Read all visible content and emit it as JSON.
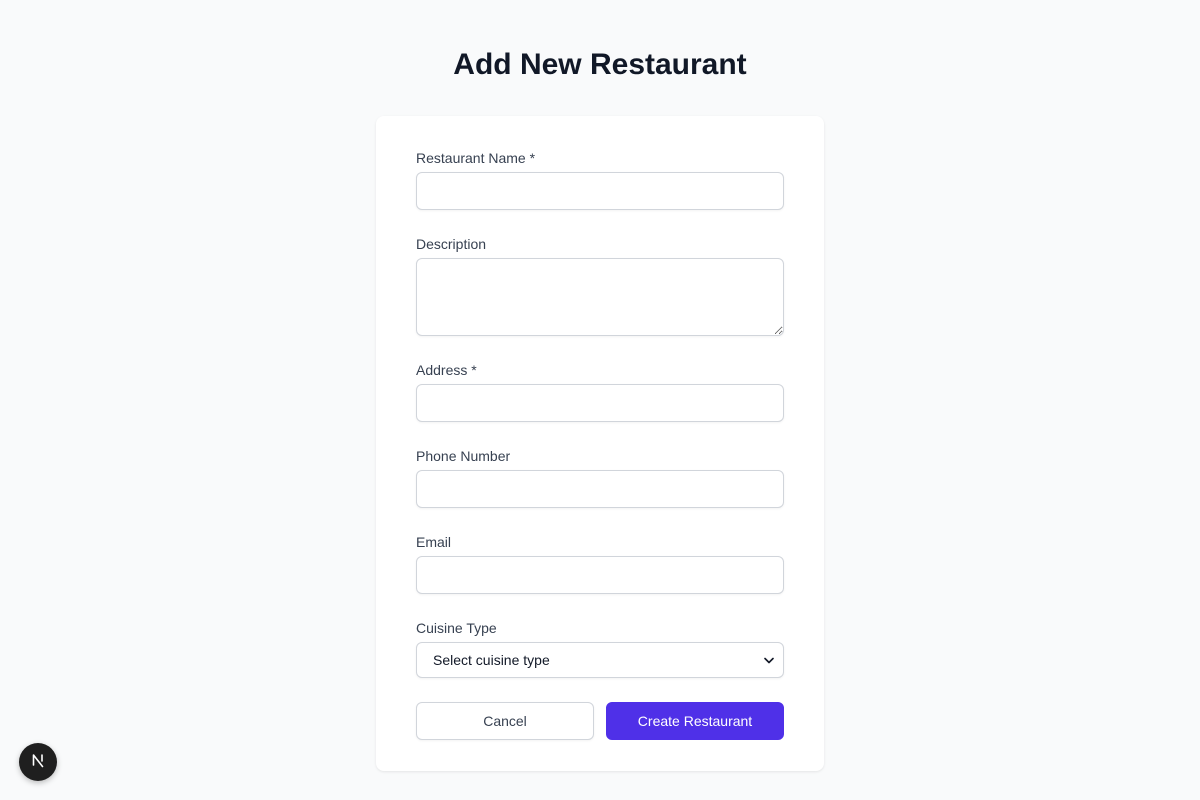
{
  "page": {
    "title": "Add New Restaurant"
  },
  "form": {
    "name_label": "Restaurant Name *",
    "name_value": "",
    "description_label": "Description",
    "description_value": "",
    "address_label": "Address *",
    "address_value": "",
    "phone_label": "Phone Number",
    "phone_value": "",
    "email_label": "Email",
    "email_value": "",
    "cuisine_label": "Cuisine Type",
    "cuisine_selected": "Select cuisine type"
  },
  "actions": {
    "cancel_label": "Cancel",
    "create_label": "Create Restaurant"
  },
  "colors": {
    "accent": "#4f30e8",
    "background": "#f9fafb",
    "card": "#ffffff",
    "border": "#d1d5db"
  },
  "icons": {
    "select_chevron": "chevron-down-icon",
    "dev_badge": "nextjs-logo-icon"
  }
}
